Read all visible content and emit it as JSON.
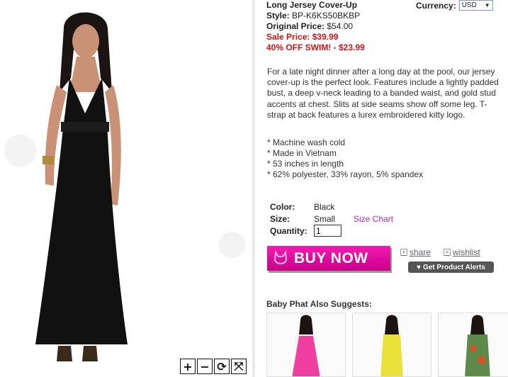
{
  "product": {
    "name": "Long Jersey Cover-Up",
    "style_label": "Style:",
    "style_value": "BP-K6KS50BKBP",
    "original_label": "Original Price:",
    "original_value": "$54.00",
    "sale_label": "Sale Price:",
    "sale_value": "$39.99",
    "promo": "40% OFF SWIM! - $23.99",
    "description": "For a late night dinner after a long day at the pool, our jersey cover-up is the perfect look. Features include a lightly padded bust, a deep v-neck leading to a banded waist, and gold stud accents at chest. Slits at side seams show off some leg. T-strap at back features a lurex embroidered kitty logo.",
    "bullets": [
      "* Machine wash cold",
      "* Made in Vietnam",
      "* 53 inches in length",
      "* 62% polyester, 33% rayon, 5% spandex"
    ]
  },
  "currency": {
    "label": "Currency:",
    "selected": "USD"
  },
  "options": {
    "color_label": "Color:",
    "color_value": "Black",
    "size_label": "Size:",
    "size_value": "Small",
    "size_chart": "Size Chart",
    "quantity_label": "Quantity:",
    "quantity_value": "1"
  },
  "actions": {
    "buy_now": "BUY NOW",
    "share": "share",
    "wishlist": "wishlist",
    "alerts": "Get Product Alerts"
  },
  "suggests": {
    "title": "Baby Phat Also Suggests:"
  },
  "colors": {
    "sale_red": "#d21313",
    "brand_pink": "#e80fa8",
    "size_chart": "#b02bb0"
  },
  "icons": [
    "zoom-in-icon",
    "zoom-out-icon",
    "rotate-icon",
    "fullscreen-icon",
    "plus-icon",
    "kitty-logo-icon",
    "heart-icon"
  ]
}
